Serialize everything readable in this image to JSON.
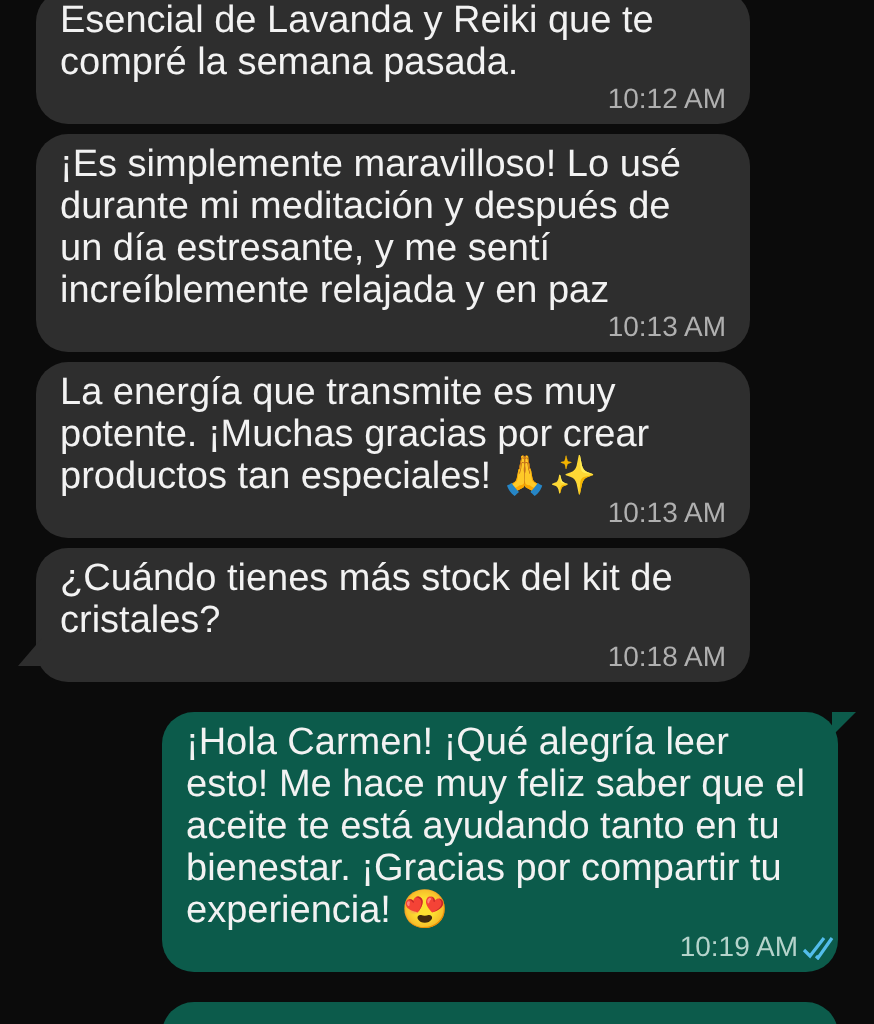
{
  "messages": [
    {
      "kind": "incoming",
      "text": "Esencial de Lavanda y Reiki que te compré la semana pasada.",
      "time": "10:12 AM",
      "tail": false
    },
    {
      "kind": "incoming",
      "text": "¡Es simplemente maravilloso! Lo usé durante mi meditación y después de un día estresante, y me sentí increíblemente relajada y en paz",
      "time": "10:13 AM",
      "tail": false
    },
    {
      "kind": "incoming",
      "text": "La energía que transmite es muy potente. ¡Muchas gracias por crear productos tan especiales! 🙏✨",
      "time": "10:13 AM",
      "tail": false
    },
    {
      "kind": "incoming",
      "text": "¿Cuándo tienes más stock del kit de cristales?",
      "time": "10:18 AM",
      "tail": true
    },
    {
      "kind": "outgoing",
      "text": "¡Hola Carmen! ¡Qué alegría leer esto! Me hace muy feliz saber que el aceite te está ayudando tanto en tu bienestar. ¡Gracias por compartir tu experiencia! 😍",
      "time": "10:19 AM",
      "read": true,
      "tail": true
    },
    {
      "kind": "outgoing",
      "tail": false
    }
  ]
}
